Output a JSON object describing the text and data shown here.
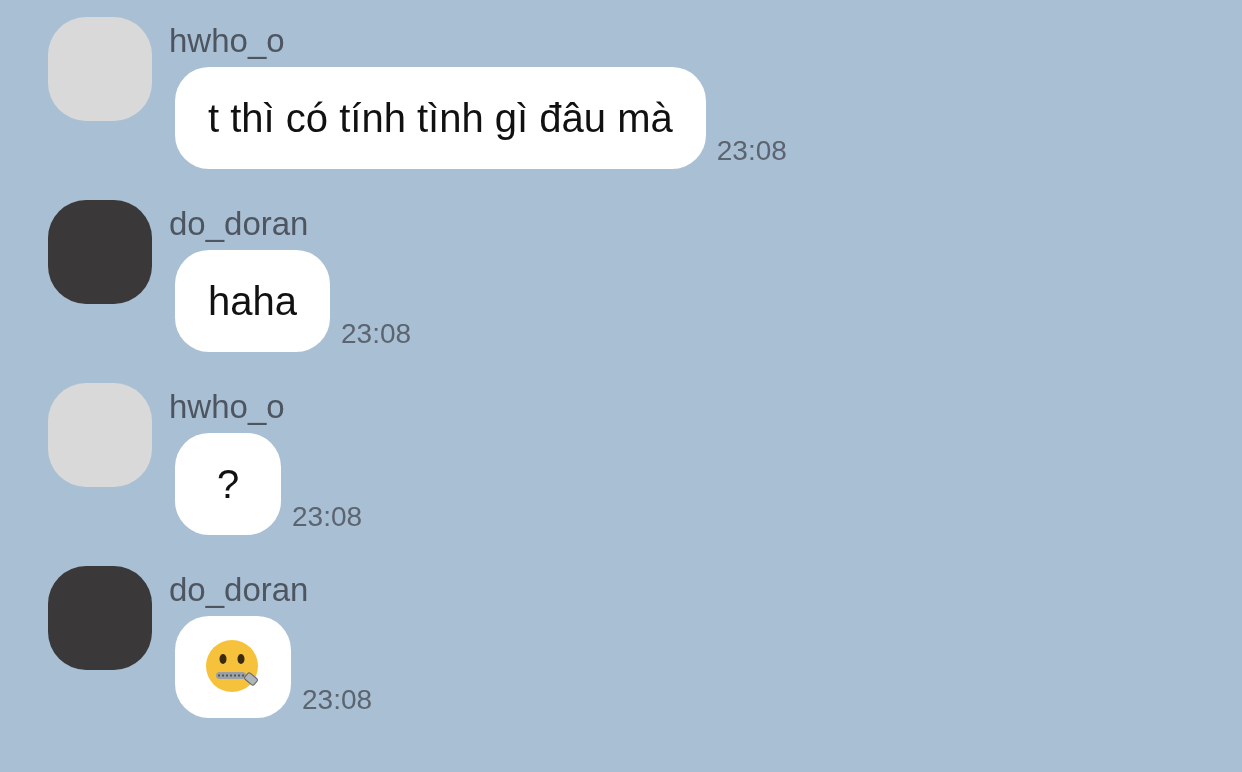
{
  "messages": [
    {
      "sender": "hwho_o",
      "kind": "text",
      "text": "t thì có tính tình gì đâu mà",
      "time": "23:08"
    },
    {
      "sender": "do_doran",
      "kind": "text",
      "text": "haha",
      "time": "23:08"
    },
    {
      "sender": "hwho_o",
      "kind": "text",
      "text": "?",
      "time": "23:08"
    },
    {
      "sender": "do_doran",
      "kind": "emoji",
      "time": "23:08"
    }
  ]
}
